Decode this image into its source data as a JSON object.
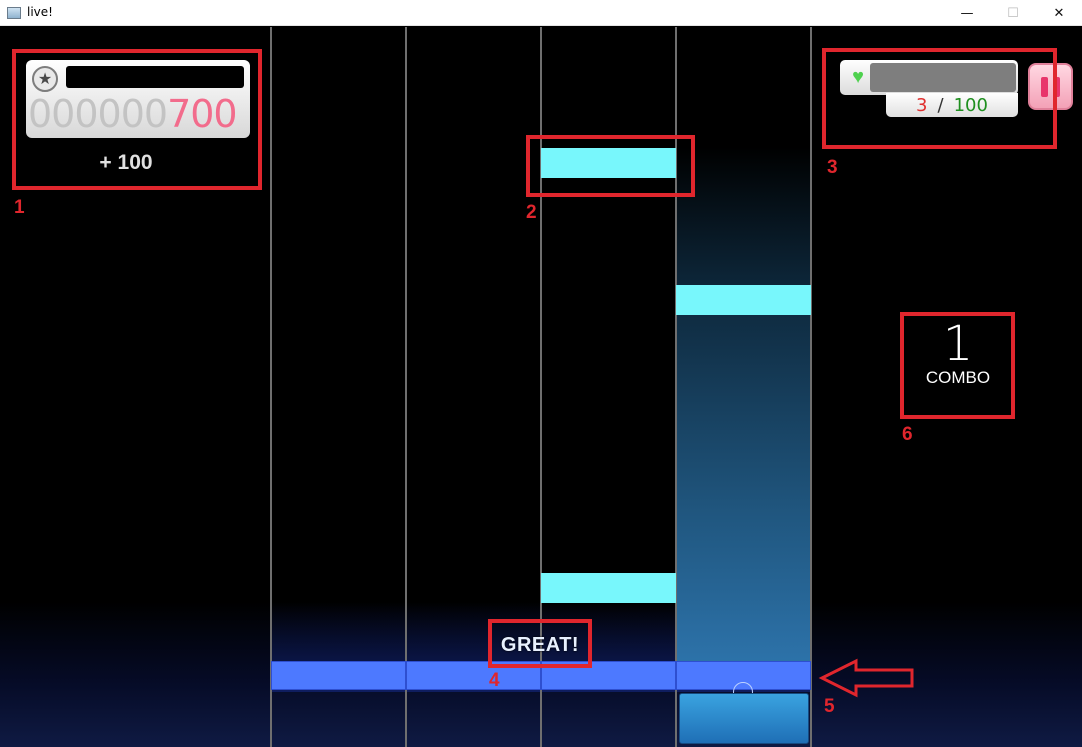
{
  "window": {
    "title": "live!",
    "minimize_glyph": "—",
    "maximize_glyph": "☐",
    "close_glyph": "✕"
  },
  "score": {
    "leading_zeros": "000000",
    "value": "700",
    "gain": "+ 100",
    "star_icon": "★"
  },
  "life": {
    "current": "3",
    "separator": "/",
    "max": "100",
    "heart_icon": "♥"
  },
  "judgement": "GREAT!",
  "combo": {
    "count": "1",
    "label": "COMBO"
  },
  "annotations": [
    "1",
    "2",
    "3",
    "4",
    "5",
    "6"
  ],
  "colors": {
    "note": "#78f7fc",
    "hit_bar": "#4d79ff",
    "annotation": "#e0262d",
    "score_highlight": "#f26c8c"
  }
}
